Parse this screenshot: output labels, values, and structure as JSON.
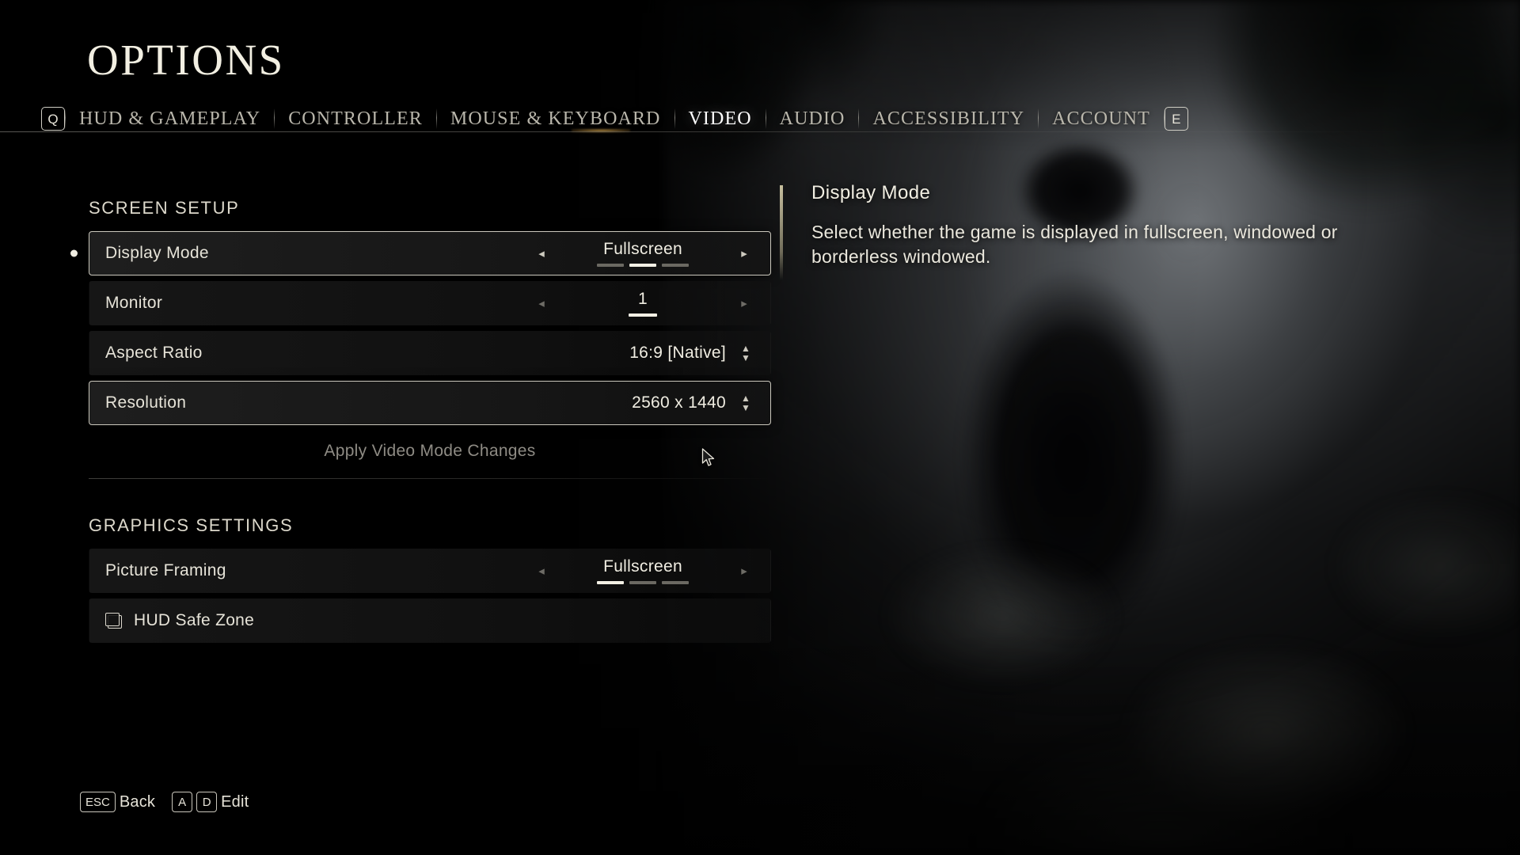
{
  "header": {
    "title": "OPTIONS",
    "left_key": "Q",
    "right_key": "E",
    "tabs": [
      {
        "label": "HUD & GAMEPLAY",
        "active": false
      },
      {
        "label": "CONTROLLER",
        "active": false
      },
      {
        "label": "MOUSE & KEYBOARD",
        "active": false
      },
      {
        "label": "VIDEO",
        "active": true
      },
      {
        "label": "AUDIO",
        "active": false
      },
      {
        "label": "ACCESSIBILITY",
        "active": false
      },
      {
        "label": "ACCOUNT",
        "active": false
      }
    ]
  },
  "screen_setup": {
    "heading": "SCREEN SETUP",
    "display_mode": {
      "label": "Display Mode",
      "value": "Fullscreen",
      "left_arrow": "◂",
      "right_arrow": "▸",
      "segments": 3,
      "active_segment": 2
    },
    "monitor": {
      "label": "Monitor",
      "value": "1",
      "left_arrow": "◂",
      "right_arrow": "▸",
      "segments": 1,
      "active_segment": 1
    },
    "aspect_ratio": {
      "label": "Aspect Ratio",
      "value": "16:9 [Native]"
    },
    "resolution": {
      "label": "Resolution",
      "value": "2560 x 1440"
    },
    "apply_label": "Apply Video Mode Changes"
  },
  "graphics_settings": {
    "heading": "GRAPHICS SETTINGS",
    "picture_framing": {
      "label": "Picture Framing",
      "value": "Fullscreen",
      "left_arrow": "◂",
      "right_arrow": "▸",
      "segments": 3,
      "active_segment": 1
    },
    "hud_safe_zone": {
      "label": "HUD Safe Zone",
      "icon": "frame-icon"
    }
  },
  "info_panel": {
    "title": "Display Mode",
    "description": "Select whether the game is displayed in fullscreen, windowed or borderless windowed."
  },
  "footer": {
    "back_key": "ESC",
    "back_label": "Back",
    "edit_key_left": "A",
    "edit_key_right": "D",
    "edit_label": "Edit"
  },
  "colors": {
    "accent": "#e0b054",
    "text": "#eae7dc",
    "dim": "#8e8b84",
    "panel": "#1a1a1a"
  }
}
